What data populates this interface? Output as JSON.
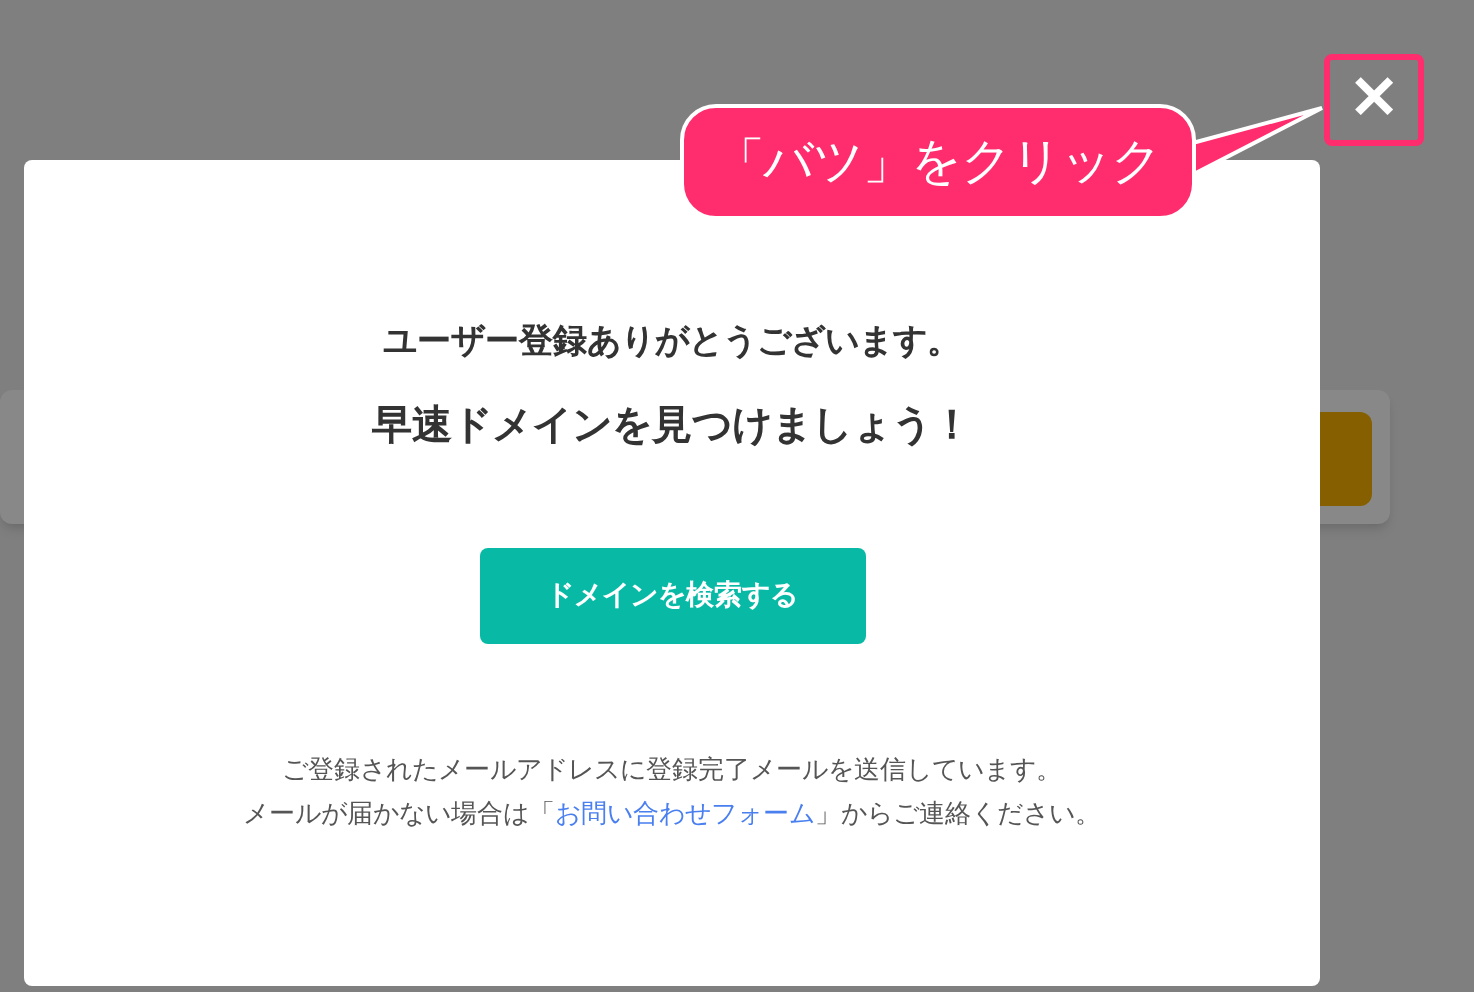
{
  "annotation": {
    "callout": "「バツ」をクリック"
  },
  "modal": {
    "close_label": "✕",
    "heading": "ユーザー登録ありがとうございます。",
    "subheading": "早速ドメインを見つけましょう！",
    "button": "ドメインを検索する",
    "note_line_1": "ご登録されたメールアドレスに登録完了メールを送信しています。",
    "note_line_2": {
      "before": "メールが届かない場合は「",
      "link": "お問い合わせフォーム",
      "after": "」からご連絡ください。"
    }
  }
}
